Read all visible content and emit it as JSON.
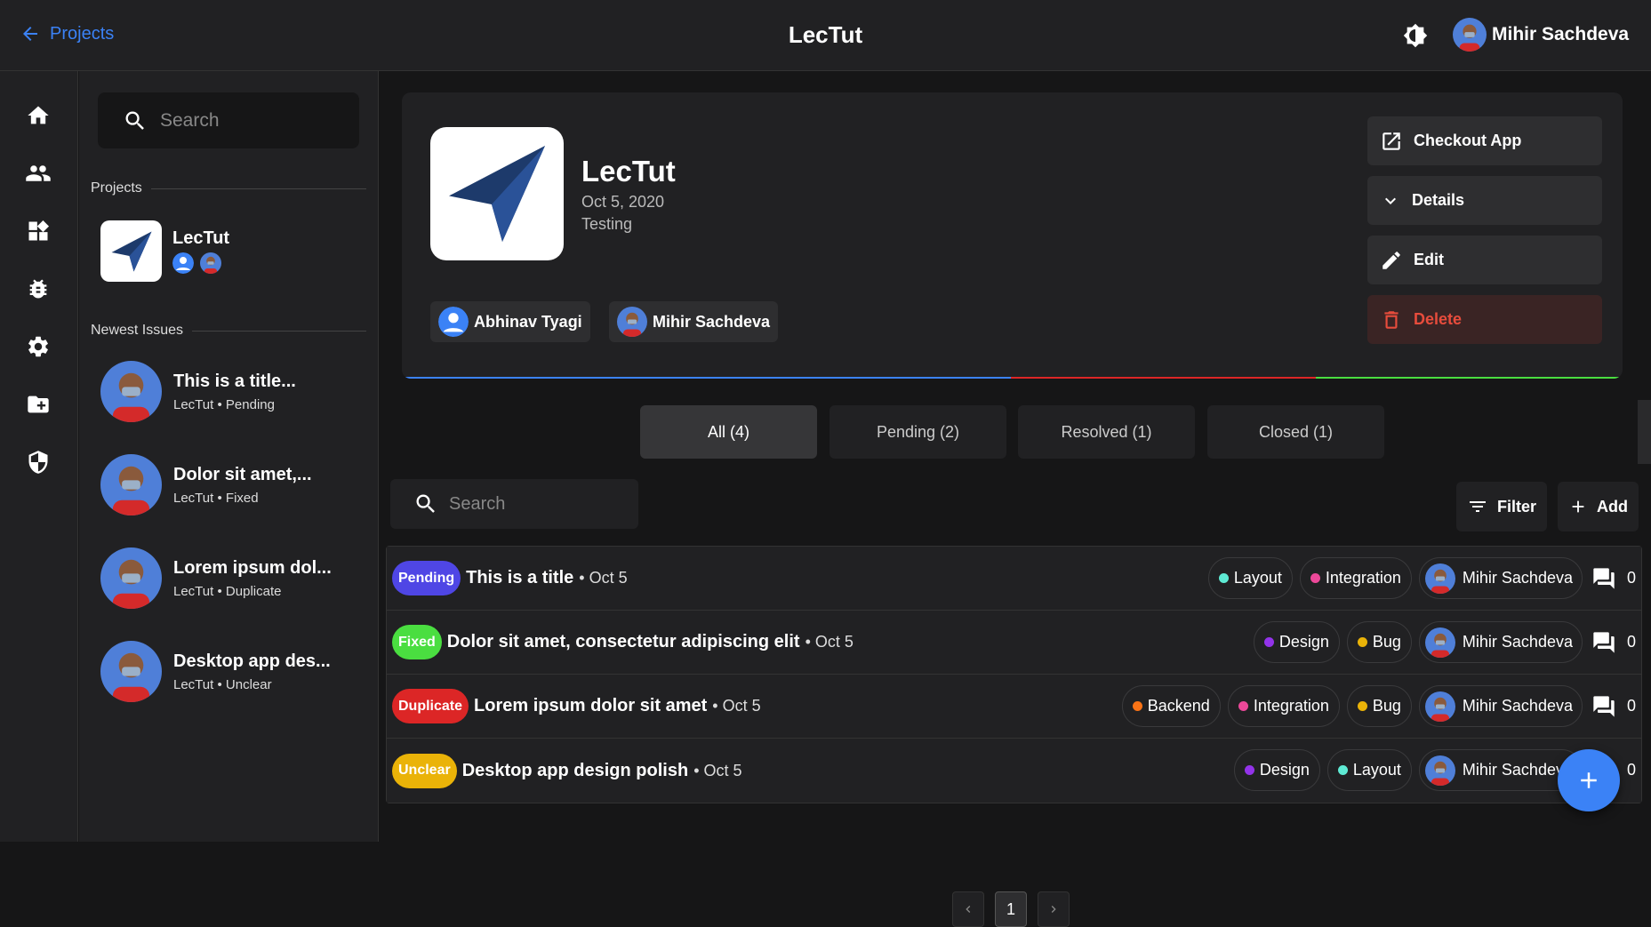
{
  "header": {
    "back_label": "Projects",
    "title": "LecTut",
    "user_name": "Mihir Sachdeva"
  },
  "sidebar": {
    "search_placeholder": "Search",
    "projects_heading": "Projects",
    "project_name": "LecTut",
    "newest_issues_heading": "Newest Issues",
    "issues": [
      {
        "title": "This is a title...",
        "project": "LecTut",
        "status": "Pending"
      },
      {
        "title": "Dolor sit amet,...",
        "project": "LecTut",
        "status": "Fixed"
      },
      {
        "title": "Lorem ipsum dol...",
        "project": "LecTut",
        "status": "Duplicate"
      },
      {
        "title": "Desktop app des...",
        "project": "LecTut",
        "status": "Unclear"
      }
    ],
    "meta_separator": "•"
  },
  "project": {
    "name": "LecTut",
    "date": "Oct 5, 2020",
    "status": "Testing",
    "members": [
      "Abhinav Tyagi",
      "Mihir Sachdeva"
    ],
    "actions": {
      "checkout": "Checkout App",
      "details": "Details",
      "edit": "Edit",
      "delete": "Delete"
    }
  },
  "tabs": [
    {
      "label": "All (4)"
    },
    {
      "label": "Pending (2)"
    },
    {
      "label": "Resolved (1)"
    },
    {
      "label": "Closed (1)"
    }
  ],
  "toolbar": {
    "search_placeholder": "Search",
    "filter_label": "Filter",
    "add_label": "Add"
  },
  "issues": [
    {
      "status": "Pending",
      "status_color": "#4f46e5",
      "title": "This is a title",
      "date": "• Oct 5",
      "tags": [
        {
          "name": "Layout",
          "color": "#5eead4"
        },
        {
          "name": "Integration",
          "color": "#ec4899"
        }
      ],
      "assignee": "Mihir Sachdeva",
      "comments": "0"
    },
    {
      "status": "Fixed",
      "status_color": "#4ade40",
      "title": "Dolor sit amet, consectetur adipiscing elit",
      "date": "• Oct 5",
      "tags": [
        {
          "name": "Design",
          "color": "#9333ea"
        },
        {
          "name": "Bug",
          "color": "#eab308"
        }
      ],
      "assignee": "Mihir Sachdeva",
      "comments": "0"
    },
    {
      "status": "Duplicate",
      "status_color": "#dc2626",
      "title": "Lorem ipsum dolor sit amet",
      "date": "• Oct 5",
      "tags": [
        {
          "name": "Backend",
          "color": "#f97316"
        },
        {
          "name": "Integration",
          "color": "#ec4899"
        },
        {
          "name": "Bug",
          "color": "#eab308"
        }
      ],
      "assignee": "Mihir Sachdeva",
      "comments": "0"
    },
    {
      "status": "Unclear",
      "status_color": "#eab308",
      "title": "Desktop app design polish",
      "date": "• Oct 5",
      "tags": [
        {
          "name": "Design",
          "color": "#9333ea"
        },
        {
          "name": "Layout",
          "color": "#5eead4"
        }
      ],
      "assignee": "Mihir Sachdeva",
      "comments": "0"
    }
  ],
  "pagination": {
    "current": "1"
  },
  "colors": {
    "accent": "#3b82f6",
    "danger": "#e74c3c",
    "background": "#161617",
    "surface": "#212123"
  }
}
